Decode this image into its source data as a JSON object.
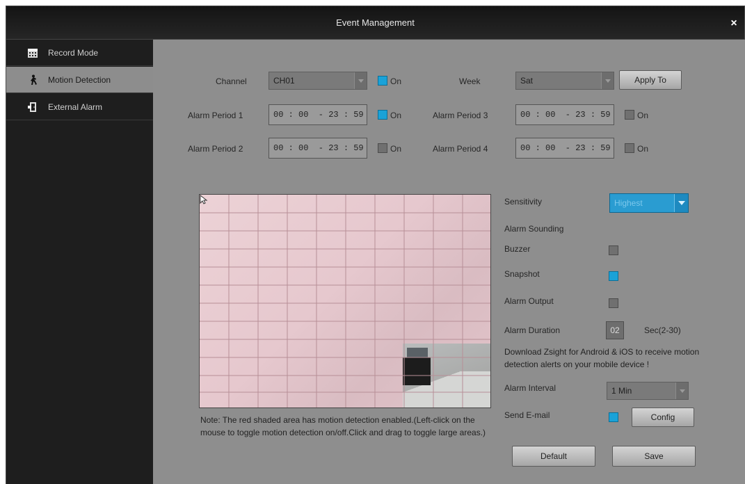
{
  "window": {
    "title": "Event Management",
    "close_label": "×"
  },
  "sidebar": {
    "items": [
      {
        "label": "Record Mode",
        "icon": "calendar-icon",
        "active": false
      },
      {
        "label": "Motion Detection",
        "icon": "running-person-icon",
        "active": true
      },
      {
        "label": "External Alarm",
        "icon": "alarm-door-icon",
        "active": false
      }
    ]
  },
  "channel": {
    "label": "Channel",
    "value": "CH01",
    "on_label": "On",
    "on_checked": true
  },
  "week": {
    "label": "Week",
    "value": "Sat",
    "apply_label": "Apply To"
  },
  "periods": [
    {
      "label": "Alarm Period 1",
      "value": "00 : 00  - 23 : 59",
      "on_label": "On",
      "checked": true
    },
    {
      "label": "Alarm Period 2",
      "value": "00 : 00  - 23 : 59",
      "on_label": "On",
      "checked": false
    },
    {
      "label": "Alarm Period 3",
      "value": "00 : 00  - 23 : 59",
      "on_label": "On",
      "checked": false
    },
    {
      "label": "Alarm Period 4",
      "value": "00 : 00  - 23 : 59",
      "on_label": "On",
      "checked": false
    }
  ],
  "settings": {
    "sensitivity_label": "Sensitivity",
    "sensitivity_value": "Highest",
    "alarm_sounding_label": "Alarm Sounding",
    "buzzer_label": "Buzzer",
    "buzzer_checked": false,
    "snapshot_label": "Snapshot",
    "snapshot_checked": true,
    "alarm_output_label": "Alarm Output",
    "alarm_output_checked": false,
    "alarm_duration_label": "Alarm Duration",
    "alarm_duration_value": "02",
    "alarm_duration_unit": "Sec(2-30)",
    "download_tip": "Download Zsight for Android & iOS to receive motion detection alerts on your mobile device !",
    "alarm_interval_label": "Alarm Interval",
    "alarm_interval_value": "1 Min",
    "send_email_label": "Send E-mail",
    "send_email_checked": true,
    "config_label": "Config"
  },
  "note": "Note: The red shaded area has motion detection enabled.(Left-click on the mouse to toggle motion detection on/off.Click and drag to toggle large areas.)",
  "buttons": {
    "default_label": "Default",
    "save_label": "Save"
  },
  "colors": {
    "accent": "#1aa2d8",
    "motion_area": "#e8cdd2",
    "sidebar": "#1e1e1e",
    "panel": "#8e8e8e"
  }
}
